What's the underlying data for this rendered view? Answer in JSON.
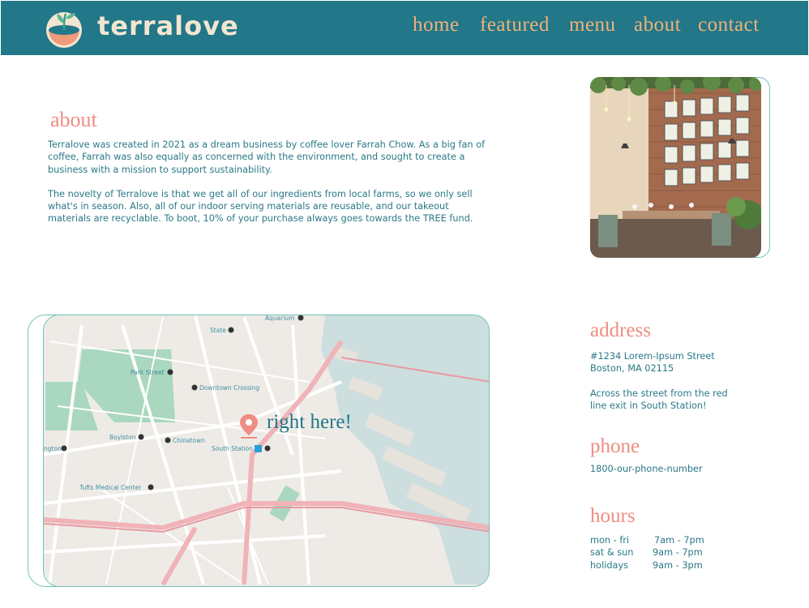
{
  "header": {
    "brand": "terralove",
    "nav": [
      "home",
      "featured",
      "menu",
      "about",
      "contact"
    ]
  },
  "about": {
    "title": "about",
    "paragraph1": "Terralove was created in 2021 as a dream business by coffee lover Farrah Chow. As a big fan of coffee, Farrah was also equally as concerned with the environment, and sought to create a business with a mission to support sustainability.",
    "paragraph2": "The novelty of Terralove is that we get all of our ingredients from local farms, so we only sell what's in season. Also, all of our indoor serving materials are reusable, and our takeout materials are recyclable. To boot, 10% of your purchase always goes towards the TREE fund."
  },
  "map": {
    "label": "right here!",
    "places": [
      "State",
      "Aquarium",
      "Park Street",
      "Downtown Crossing",
      "Boylston",
      "Chinatown",
      "South Station",
      "Tufts Medical Center",
      "ngton"
    ]
  },
  "address": {
    "title": "address",
    "line1": "#1234 Lorem-Ipsum Street",
    "line2": "Boston, MA 02115",
    "note_line1": "Across the street from the red",
    "note_line2": "line exit in South Station!"
  },
  "phone": {
    "title": "phone",
    "number": "1800-our-phone-number"
  },
  "hours": {
    "title": "hours",
    "rows": [
      {
        "day": "mon - fri",
        "time": "7am - 7pm"
      },
      {
        "day": "sat & sun",
        "time": "9am - 7pm"
      },
      {
        "day": "holidays",
        "time": "9am - 3pm"
      }
    ]
  },
  "colors": {
    "header_bg": "#227788",
    "nav_text": "#f0b27a",
    "accent_heading": "#ee8d82",
    "body_text": "#2a7888",
    "frame_border": "#6fc3b5"
  }
}
